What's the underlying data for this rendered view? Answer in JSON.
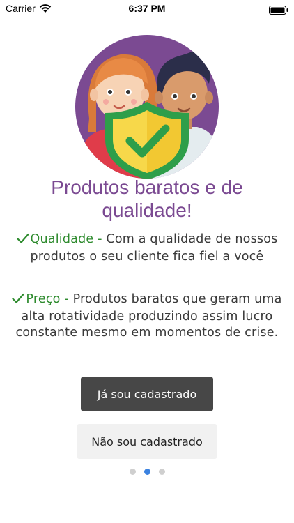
{
  "status_bar": {
    "carrier": "Carrier",
    "time": "6:37 PM",
    "wifi_icon": "wifi-icon",
    "battery_icon": "battery-icon"
  },
  "hero": {
    "icon": "people-shield-check-illustration",
    "background_color": "#7b4a92",
    "shield_color": "#2e9e4a",
    "shield_inner_color": "#f7d84a"
  },
  "headline": "Produtos baratos e de qualidade!",
  "features": [
    {
      "icon": "check-icon",
      "term": "Qualidade -",
      "text": "Com a qualidade de nossos produtos o seu cliente fica fiel a você"
    },
    {
      "icon": "check-icon",
      "term": "Preço -",
      "text": "Produtos baratos que geram uma alta rotatividade produzindo assim lucro constante mesmo em momentos de crise."
    }
  ],
  "buttons": {
    "registered_label": "Já sou cadastrado",
    "not_registered_label": "Não sou cadastrado"
  },
  "pagination": {
    "total": 3,
    "current": 2
  },
  "colors": {
    "accent_purple": "#7b4a92",
    "accent_green": "#2e8b2e",
    "dot_active": "#3b82e0",
    "dot_inactive": "#cfcfcf"
  }
}
